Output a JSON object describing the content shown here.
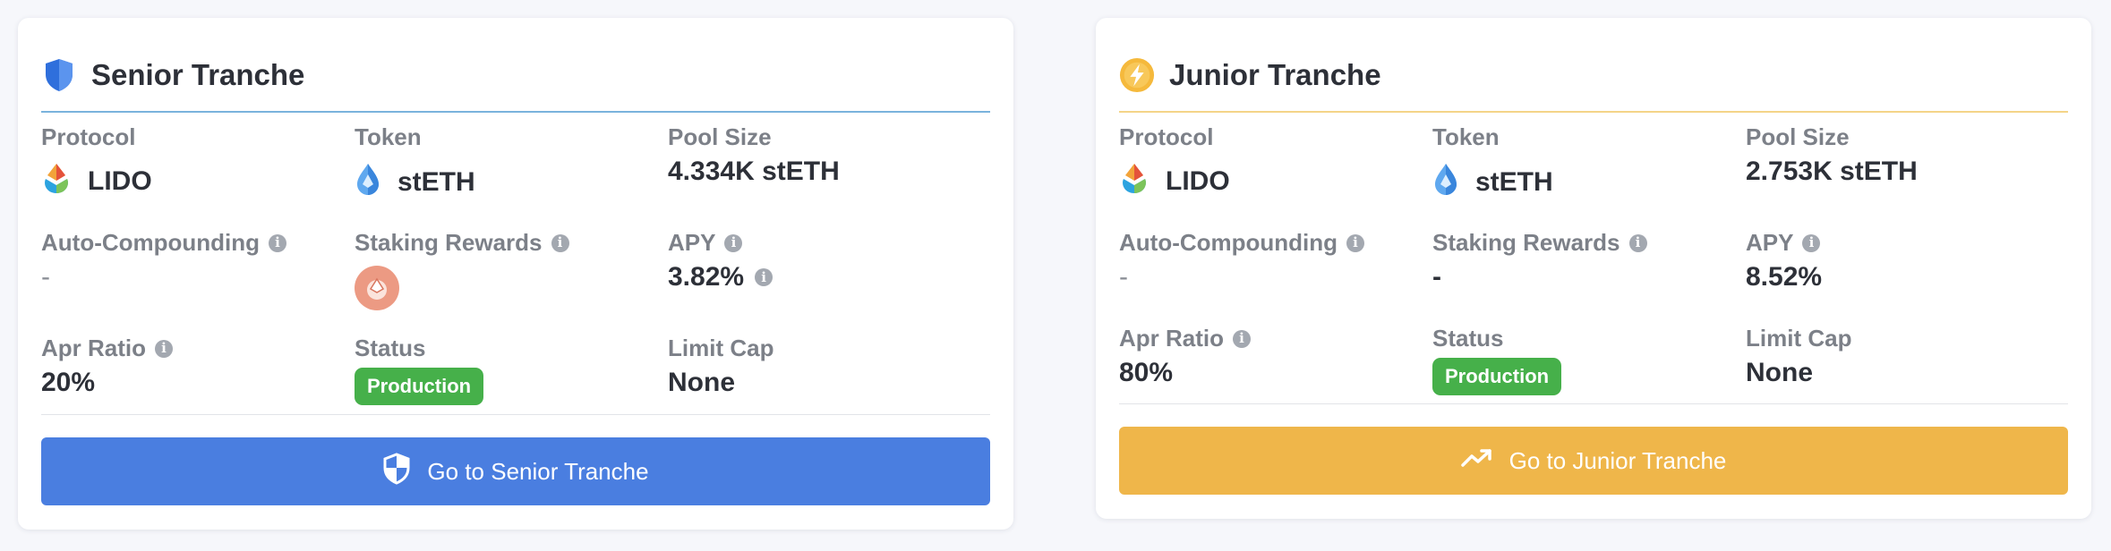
{
  "senior": {
    "title": "Senior Tranche",
    "header_icon": "shield-icon",
    "protocol_label": "Protocol",
    "protocol_value": "LIDO",
    "token_label": "Token",
    "token_value": "stETH",
    "pool_size_label": "Pool Size",
    "pool_size_value": "4.334K stETH",
    "auto_compounding_label": "Auto-Compounding",
    "auto_compounding_value": "-",
    "staking_rewards_label": "Staking Rewards",
    "staking_rewards_icon": "reward-token-icon",
    "apy_label": "APY",
    "apy_value": "3.82%",
    "apr_ratio_label": "Apr Ratio",
    "apr_ratio_value": "20%",
    "status_label": "Status",
    "status_value": "Production",
    "limit_cap_label": "Limit Cap",
    "limit_cap_value": "None",
    "cta_label": "Go to Senior Tranche",
    "colors": {
      "accent": "#4a7ee0",
      "header_line": "#7ab3dd"
    }
  },
  "junior": {
    "title": "Junior Tranche",
    "header_icon": "lightning-icon",
    "protocol_label": "Protocol",
    "protocol_value": "LIDO",
    "token_label": "Token",
    "token_value": "stETH",
    "pool_size_label": "Pool Size",
    "pool_size_value": "2.753K stETH",
    "auto_compounding_label": "Auto-Compounding",
    "auto_compounding_value": "-",
    "staking_rewards_label": "Staking Rewards",
    "staking_rewards_value": "-",
    "apy_label": "APY",
    "apy_value": "8.52%",
    "apr_ratio_label": "Apr Ratio",
    "apr_ratio_value": "80%",
    "status_label": "Status",
    "status_value": "Production",
    "limit_cap_label": "Limit Cap",
    "limit_cap_value": "None",
    "cta_label": "Go to Junior Tranche",
    "colors": {
      "accent": "#efb64a",
      "header_line": "#f4d488"
    }
  },
  "colors": {
    "status_badge": "#46b04a",
    "background": "#f6f7fb"
  }
}
